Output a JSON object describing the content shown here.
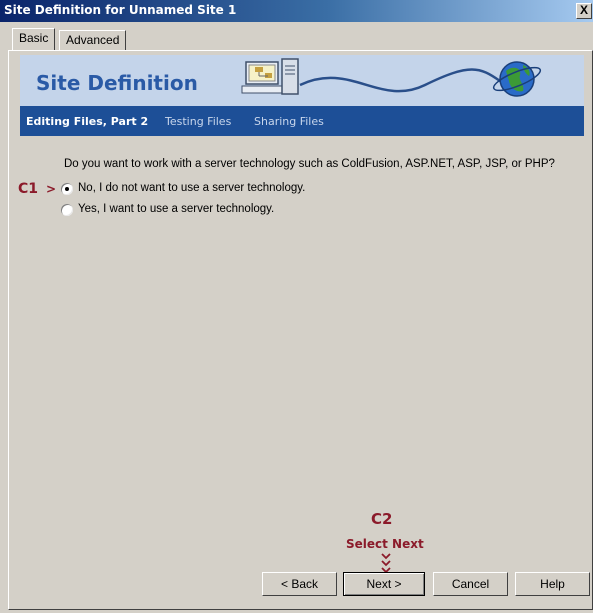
{
  "window": {
    "title": "Site Definition for Unnamed Site 1",
    "close_label": "X"
  },
  "tabs": [
    {
      "label": "Basic"
    },
    {
      "label": "Advanced"
    }
  ],
  "banner": {
    "title": "Site Definition"
  },
  "steps": [
    {
      "label": "Editing Files, Part 2"
    },
    {
      "label": "Testing Files"
    },
    {
      "label": "Sharing Files"
    }
  ],
  "question": "Do you want to work with a server technology such as ColdFusion, ASP.NET, ASP, JSP, or PHP?",
  "options": [
    {
      "label": "No, I do not want to use a server technology.",
      "selected": true
    },
    {
      "label": "Yes, I want to use a server technology.",
      "selected": false
    }
  ],
  "callouts": {
    "c1": "C1",
    "c1_arrow": ">",
    "c2": "C2",
    "c2_text": "Select Next"
  },
  "buttons": {
    "back": "< Back",
    "next": "Next >",
    "cancel": "Cancel",
    "help": "Help"
  },
  "colors": {
    "callout": "#8b1a2a",
    "step_bar": "#1d4f97",
    "banner": "#c4d4ea"
  }
}
